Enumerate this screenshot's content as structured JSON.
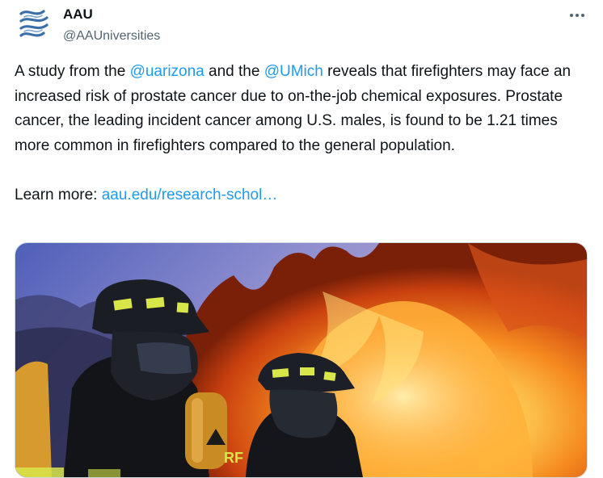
{
  "author": {
    "display_name": "AAU",
    "handle": "@AAUniversities",
    "avatar_icon": "aau-logo-icon"
  },
  "menu": {
    "icon": "more-horizontal-icon"
  },
  "tweet": {
    "text_1": "A study from the ",
    "mention_1": "@uarizona",
    "text_2": " and the ",
    "mention_2": "@UMich",
    "text_3": " reveals that firefighters may face an increased risk of prostate cancer due to on-the-job chemical exposures. Prostate cancer, the leading incident cancer among U.S. males, is found to be 1.21 times more common in firefighters compared to the general population.",
    "learn_more": "Learn more: ",
    "link_text": "aau.edu/research-schol…"
  },
  "media": {
    "description_icon": "firefighters-photo",
    "helmet_badge": "RF"
  },
  "colors": {
    "link": "#1d9bf0",
    "text": "#0f1419",
    "secondary": "#536471",
    "logo_blue": "#3a6fa8"
  }
}
